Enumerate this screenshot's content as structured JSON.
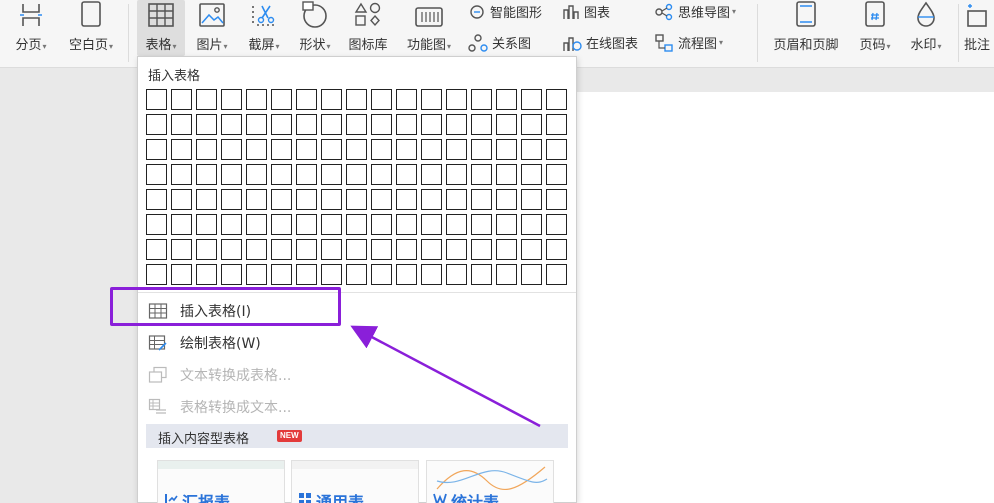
{
  "ribbon": {
    "buttons": [
      {
        "id": "page-break",
        "label": "分页",
        "icon": "page-break-icon",
        "dropdown": true
      },
      {
        "id": "blank-page",
        "label": "空白页",
        "icon": "blank-page-icon",
        "dropdown": true
      },
      {
        "id": "table",
        "label": "表格",
        "icon": "table-icon",
        "dropdown": true,
        "active": true
      },
      {
        "id": "picture",
        "label": "图片",
        "icon": "picture-icon",
        "dropdown": true
      },
      {
        "id": "screenshot",
        "label": "截屏",
        "icon": "screenshot-icon",
        "dropdown": true
      },
      {
        "id": "shape",
        "label": "形状",
        "icon": "shape-icon",
        "dropdown": true
      },
      {
        "id": "icon-library",
        "label": "图标库",
        "icon": "icon-library-icon",
        "dropdown": false
      },
      {
        "id": "function-chart",
        "label": "功能图",
        "icon": "function-chart-icon",
        "dropdown": true
      },
      {
        "id": "header-footer",
        "label": "页眉和页脚",
        "icon": "header-footer-icon",
        "dropdown": false
      },
      {
        "id": "page-number",
        "label": "页码",
        "icon": "page-number-icon",
        "dropdown": true
      },
      {
        "id": "watermark",
        "label": "水印",
        "icon": "watermark-icon",
        "dropdown": true
      },
      {
        "id": "comment",
        "label": "批注",
        "icon": "comment-icon",
        "dropdown": false
      }
    ],
    "small_buttons": [
      {
        "id": "smart-graphic",
        "label": "智能图形",
        "icon": "smart-graphic-icon"
      },
      {
        "id": "chart",
        "label": "图表",
        "icon": "chart-icon"
      },
      {
        "id": "mind-map",
        "label": "思维导图",
        "icon": "mind-map-icon",
        "dropdown": true
      },
      {
        "id": "relation-chart",
        "label": "关系图",
        "icon": "relation-chart-icon"
      },
      {
        "id": "online-chart",
        "label": "在线图表",
        "icon": "online-chart-icon"
      },
      {
        "id": "flowchart",
        "label": "流程图",
        "icon": "flowchart-icon",
        "dropdown": true
      }
    ],
    "dropdown_arrow": "▾"
  },
  "menu": {
    "title": "插入表格",
    "grid": {
      "cols": 17,
      "rows": 8
    },
    "items": [
      {
        "id": "insert-table",
        "label": "插入表格(I)",
        "icon": "insert-table-icon",
        "enabled": true
      },
      {
        "id": "draw-table",
        "label": "绘制表格(W)",
        "icon": "draw-table-icon",
        "enabled": true
      },
      {
        "id": "text-to-table",
        "label": "文本转换成表格...",
        "icon": "text-to-table-icon",
        "enabled": false
      },
      {
        "id": "table-to-text",
        "label": "表格转换成文本...",
        "icon": "table-to-text-icon",
        "enabled": false
      }
    ],
    "section": {
      "label": "插入内容型表格",
      "badge": "NEW"
    },
    "templates": [
      {
        "label": "汇报表"
      },
      {
        "label": "通用表"
      },
      {
        "label": "统计表"
      }
    ]
  },
  "colors": {
    "highlight": "#8a1fd9",
    "badge": "#e33b3b"
  }
}
